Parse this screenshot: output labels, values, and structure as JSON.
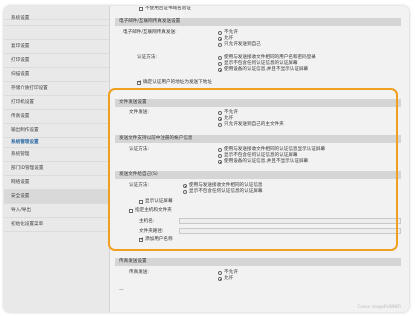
{
  "sidebar": {
    "items": [
      {
        "label": "",
        "header": false
      },
      {
        "label": "系统设置",
        "header": false
      },
      {
        "label": "",
        "header": false
      },
      {
        "label": "复印设置",
        "header": false
      },
      {
        "label": "打印设置",
        "header": false
      },
      {
        "label": "扫描设置",
        "header": false
      },
      {
        "label": "存储介质打印设置",
        "header": false
      },
      {
        "label": "打印机设置",
        "header": false
      },
      {
        "label": "传真设置",
        "header": false
      },
      {
        "label": "输出制作设置",
        "header": false
      },
      {
        "label": "系统管理设置",
        "header": true
      },
      {
        "label": "系统管理",
        "header": false
      },
      {
        "label": "部门ID管理设置",
        "header": false
      },
      {
        "label": "网络设置",
        "header": false
      },
      {
        "label": "安全设置",
        "header": false,
        "active": true
      },
      {
        "label": "导入/导出",
        "header": false
      },
      {
        "label": "初始化设置菜单",
        "header": false
      }
    ]
  },
  "top": {
    "line1": "",
    "line2": "不使用且证书域名验证"
  },
  "sec_email": {
    "title": "电子邮件/互联网传真发送设置",
    "use_tls_label": "电子邮件/互联网传真发送:",
    "use_tls_options": [
      "不允许",
      "允许",
      "只允许发送到自己"
    ],
    "auth_label": "认证方法:",
    "auth_options": [
      "使用与发送接收文件相同的用户名和密码登录",
      "显示不包含任何认证信息的认证屏幕",
      "使用设备的认证信息,并且不显示认证屏幕"
    ],
    "check_label": "确定认证用户的地址为发送下地址"
  },
  "sec_file": {
    "title": "文件发送设置",
    "send_label": "文件发送:",
    "send_options": [
      "不允许",
      "允许",
      "只允许发送到自己的主文件夹"
    ]
  },
  "sec_login": {
    "title": "发送文件支持以前中注册的帐户信息",
    "auth_label": "认证方法:",
    "auth_options": [
      "使用与发送接收文件相同的认证信息显示认证屏幕",
      "显示不包含任何认证信息的认证屏幕",
      "使用设备的认证信息,并且不显示认证屏幕"
    ]
  },
  "sec_folder": {
    "title": "发送文件给自己(S)",
    "auth_label": "认证方法:",
    "auth_options": [
      "使用与发送接收文件相同的认证信息",
      "显示不包含任何认证信息的认证屏幕"
    ],
    "show_auth_label": "显示认证屏幕",
    "specify_label": "指定主机和文件夹",
    "host_label": "主机名:",
    "path_label": "文件夹路径:",
    "add_user_label": "添加用户名称"
  },
  "sec_print": {
    "title": "传真发送设置",
    "send_label": "传真发送:",
    "send_options": [
      "不允许",
      "允许"
    ]
  },
  "footer_mark": "Canon imageRUNNER"
}
